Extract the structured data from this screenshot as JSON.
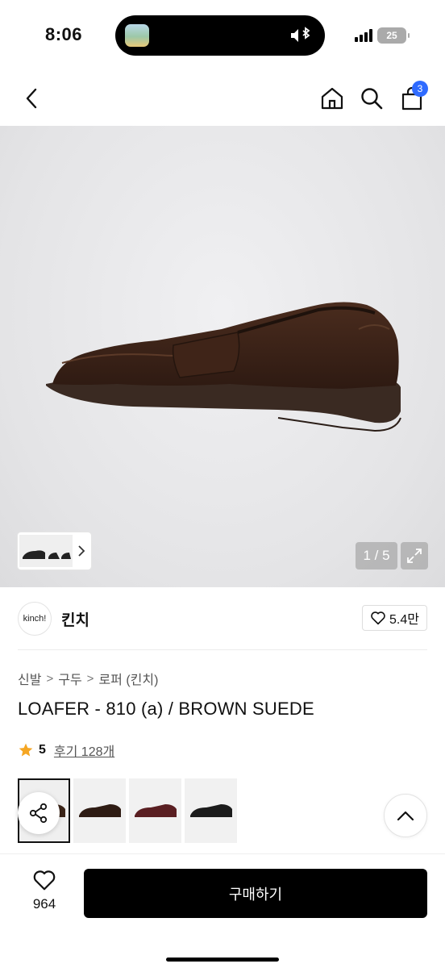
{
  "status": {
    "time": "8:06",
    "battery": "25",
    "icons": [
      "signal-icon",
      "battery-icon",
      "bluetooth-icon",
      "mute-icon"
    ]
  },
  "nav": {
    "icons": [
      "chevron-left-icon",
      "home-icon",
      "search-icon",
      "shopping-bag-icon"
    ],
    "cart_count": "3"
  },
  "gallery": {
    "counter": "1 / 5",
    "current_index": 1,
    "total": 5,
    "background_color": "#e6e6e8",
    "shoe_color": "#3b2418"
  },
  "brand": {
    "logo_text": "kinch!",
    "name": "킨치",
    "likes": "5.4만"
  },
  "breadcrumb": {
    "items": [
      "신발",
      "구두",
      "로퍼 (킨치)"
    ],
    "separator": ">"
  },
  "product": {
    "title": "LOAFER - 810 (a) / BROWN SUEDE",
    "rating": "5",
    "reviews": "후기 128개",
    "star_color": "#f5a623"
  },
  "color_options": {
    "colors": [
      "#3b2418",
      "#2f1c14",
      "#5a1f22",
      "#1c1c1c"
    ],
    "selected_index": 0
  },
  "bottom": {
    "wish_count": "964",
    "buy_label": "구매하기",
    "buy_color": "#000000"
  },
  "accent": {
    "badge_color": "#2f6bff"
  }
}
